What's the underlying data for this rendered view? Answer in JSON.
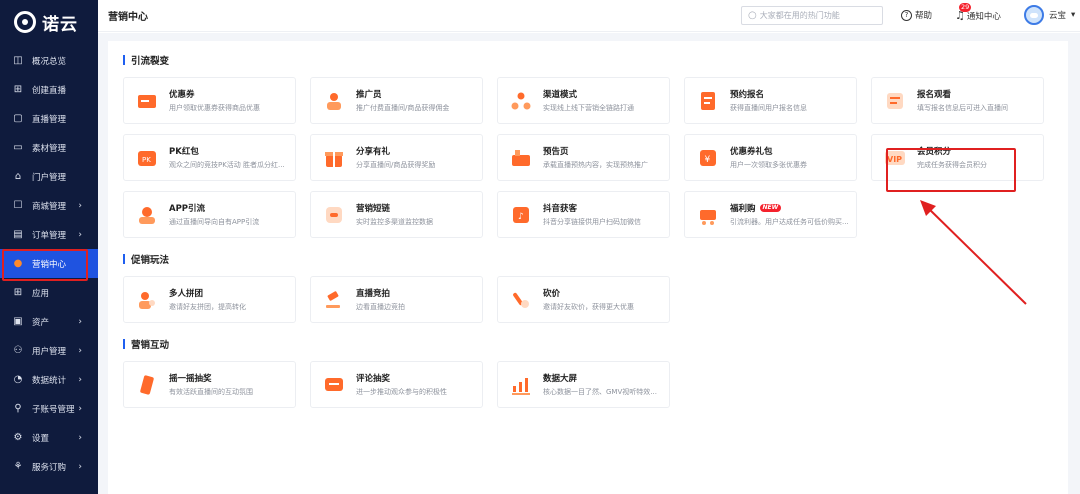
{
  "brand": {
    "name": "诺云"
  },
  "sidebar": {
    "items": [
      {
        "label": "概况总览",
        "icon": "dashboard-icon",
        "glyph": "◫"
      },
      {
        "label": "创建直播",
        "icon": "plus-square-icon",
        "glyph": "⊞"
      },
      {
        "label": "直播管理",
        "icon": "monitor-icon",
        "glyph": "▢"
      },
      {
        "label": "素材管理",
        "icon": "folder-icon",
        "glyph": "▭"
      },
      {
        "label": "门户管理",
        "icon": "home-icon",
        "glyph": "⌂"
      },
      {
        "label": "商城管理",
        "icon": "bag-icon",
        "glyph": "☐",
        "chevron": "›"
      },
      {
        "label": "订单管理",
        "icon": "document-icon",
        "glyph": "▤",
        "chevron": "›"
      },
      {
        "label": "营销中心",
        "icon": "flame-icon",
        "glyph": "●",
        "active": true
      },
      {
        "label": "应用",
        "icon": "apps-icon",
        "glyph": "⊞"
      },
      {
        "label": "资产",
        "icon": "wallet-icon",
        "glyph": "▣",
        "chevron": "›"
      },
      {
        "label": "用户管理",
        "icon": "user-icon",
        "glyph": "⚇",
        "chevron": "›"
      },
      {
        "label": "数据统计",
        "icon": "chart-icon",
        "glyph": "◔",
        "chevron": "›"
      },
      {
        "label": "子账号管理",
        "icon": "subaccount-icon",
        "glyph": "⚲",
        "chevron": "›"
      },
      {
        "label": "设置",
        "icon": "gear-icon",
        "glyph": "⚙",
        "chevron": "›"
      },
      {
        "label": "服务订购",
        "icon": "service-icon",
        "glyph": "⚘",
        "chevron": "›"
      }
    ]
  },
  "header": {
    "title": "营销中心",
    "search_placeholder": "大家都在用的热门功能",
    "help_label": "帮助",
    "notify_label": "通知中心",
    "notify_count": "29",
    "user_name": "云宝"
  },
  "colors": {
    "accent": "#1f53e0",
    "sidebar_bg": "#0f1b3d",
    "icon_orange": "#ff6a2b",
    "highlight": "#e02020"
  },
  "sections": [
    {
      "title": "引流裂变",
      "cards": [
        {
          "name": "优惠券",
          "desc": "用户领取优惠券获得商品优惠",
          "icon": "coupon-icon"
        },
        {
          "name": "推广员",
          "desc": "推广付费直播间/商品获得佣金",
          "icon": "promoter-icon"
        },
        {
          "name": "渠道模式",
          "desc": "实现线上线下营销全链路打通",
          "icon": "channel-icon"
        },
        {
          "name": "预约报名",
          "desc": "获得直播间用户报名信息",
          "icon": "registration-icon"
        },
        {
          "name": "报名观看",
          "desc": "填写报名信息后可进入直播间",
          "icon": "signup-watch-icon"
        },
        {
          "name": "PK红包",
          "desc": "观众之间的竞技PK活动 胜者瓜分红...",
          "icon": "pk-redpacket-icon"
        },
        {
          "name": "分享有礼",
          "desc": "分享直播间/商品获得奖励",
          "icon": "share-gift-icon"
        },
        {
          "name": "预告页",
          "desc": "承载直播预热内容，实现预热推广",
          "icon": "preview-page-icon"
        },
        {
          "name": "优惠券礼包",
          "desc": "用户一次领取多张优惠券",
          "icon": "coupon-pack-icon"
        },
        {
          "name": "会员积分",
          "desc": "完成任务获得会员积分",
          "icon": "vip-points-icon"
        },
        {
          "name": "APP引流",
          "desc": "通过直播间导向自有APP引流",
          "icon": "app-traffic-icon"
        },
        {
          "name": "营销短链",
          "desc": "实时监控多渠道监控数据",
          "icon": "shortlink-icon"
        },
        {
          "name": "抖音获客",
          "desc": "抖音分享链接供用户扫码加微信",
          "icon": "douyin-icon"
        },
        {
          "name": "福利购",
          "desc": "引流利器。用户达成任务可低价购买...",
          "icon": "welfare-cart-icon",
          "tag": "NEW"
        }
      ]
    },
    {
      "title": "促销玩法",
      "cards": [
        {
          "name": "多人拼团",
          "desc": "邀请好友拼团，提高转化",
          "icon": "group-buy-icon"
        },
        {
          "name": "直播竞拍",
          "desc": "边看直播边竞拍",
          "icon": "auction-icon"
        },
        {
          "name": "砍价",
          "desc": "邀请好友砍价，获得更大优惠",
          "icon": "bargain-icon"
        }
      ]
    },
    {
      "title": "营销互动",
      "cards": [
        {
          "name": "摇一摇抽奖",
          "desc": "有效活跃直播间的互动氛围",
          "icon": "shake-lottery-icon"
        },
        {
          "name": "评论抽奖",
          "desc": "进一步推动观众参与的积极性",
          "icon": "comment-lottery-icon"
        },
        {
          "name": "数据大屏",
          "desc": "核心数据一目了然、GMV视听特效...",
          "icon": "data-screen-icon"
        }
      ]
    }
  ]
}
